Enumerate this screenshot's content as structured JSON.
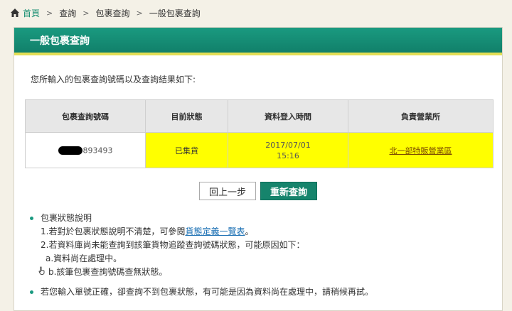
{
  "breadcrumb": {
    "home": "首頁",
    "items": [
      "查詢",
      "包裹查詢",
      "一般包裹查詢"
    ]
  },
  "panel": {
    "title": "一般包裹查詢",
    "intro": "您所輸入的包裹查詢號碼以及查詢結果如下:"
  },
  "table": {
    "headers": [
      "包裹查詢號碼",
      "目前狀態",
      "資料登入時間",
      "負責營業所"
    ],
    "row": {
      "package_suffix": "893493",
      "status": "已集貨",
      "date": "2017/07/01",
      "time": "15:16",
      "branch": "北一部特販營業區"
    }
  },
  "buttons": {
    "back": "回上一步",
    "requery": "重新查詢"
  },
  "notes": {
    "heading": "包裹狀態說明",
    "line1_prefix": "1.若對於包裹狀態說明不清楚，可參閱",
    "line1_link": "貨態定義一覽表",
    "line1_suffix": "。",
    "line2": "2.若資料庫尚未能查詢到該筆貨物追蹤查詢號碼狀態，可能原因如下：",
    "line_a": "a.資料尚在處理中。",
    "line_b": "b.該筆包裹查詢號碼查無狀態。",
    "bottom": "若您輸入單號正確，卻查詢不到包裹狀態，有可能是因為資料尚在處理中，請稍候再試。"
  },
  "colors": {
    "accent": "#1a9a80",
    "highlight": "#ffff00",
    "header_stripe": "#e4de55"
  }
}
